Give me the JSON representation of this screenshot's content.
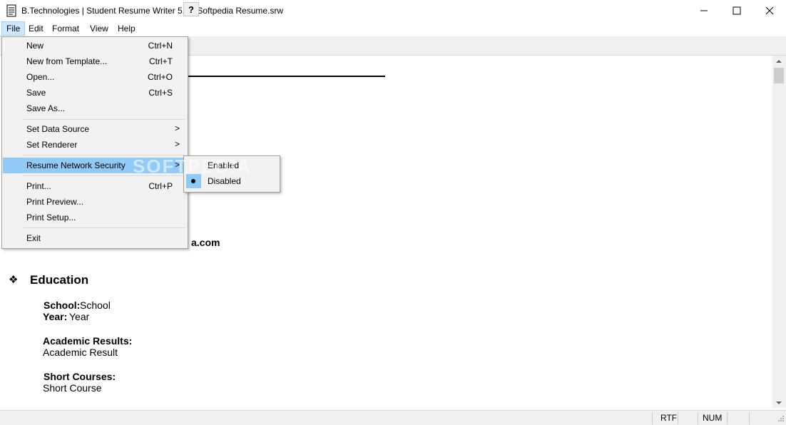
{
  "window": {
    "title": "B.Technologies | Student Resume Writer 5.0 - Softpedia Resume.srw",
    "app_icon": "document-icon",
    "controls": [
      "minimize-icon",
      "maximize-icon",
      "close-icon"
    ]
  },
  "menubar": {
    "items": [
      {
        "label": "File"
      },
      {
        "label": "Edit"
      },
      {
        "label": "Format"
      },
      {
        "label": "View"
      },
      {
        "label": "Help"
      }
    ]
  },
  "toolbar": {
    "help_label": "?"
  },
  "file_menu": {
    "items": [
      {
        "label": "New",
        "shortcut": "Ctrl+N"
      },
      {
        "label": "New from Template...",
        "shortcut": "Ctrl+T"
      },
      {
        "label": "Open...",
        "shortcut": "Ctrl+O"
      },
      {
        "label": "Save",
        "shortcut": "Ctrl+S"
      },
      {
        "label": "Save As...",
        "shortcut": ""
      },
      {
        "label": "Set Data Source",
        "shortcut": ""
      },
      {
        "label": "Set Renderer",
        "shortcut": ""
      },
      {
        "label": "Resume Network Security",
        "shortcut": ""
      },
      {
        "label": "Print...",
        "shortcut": "Ctrl+P"
      },
      {
        "label": "Print Preview...",
        "shortcut": ""
      },
      {
        "label": "Print Setup...",
        "shortcut": ""
      },
      {
        "label": "Exit",
        "shortcut": ""
      }
    ],
    "submenu_arrow": ">"
  },
  "security_submenu": {
    "items": [
      {
        "label": "Enabled",
        "selected": false
      },
      {
        "label": "Disabled",
        "selected": true
      }
    ]
  },
  "document": {
    "email_fragment": "a.com",
    "education_bullet": "❖",
    "education_heading": "Education",
    "school_label": "School:",
    "school_value": "School",
    "year_label": "Year:",
    "year_value": "Year",
    "academic_label": "Academic Results:",
    "academic_value": "Academic Result",
    "courses_label": "Short Courses:",
    "courses_value": "Short Course"
  },
  "watermark": "SOFTPEDIA",
  "statusbar": {
    "mode": "RTF",
    "num": "NUM"
  },
  "colors": {
    "highlight": "#91c9f7",
    "menu_bg": "#f2f2f2",
    "active_menu": "#cce8ff"
  }
}
